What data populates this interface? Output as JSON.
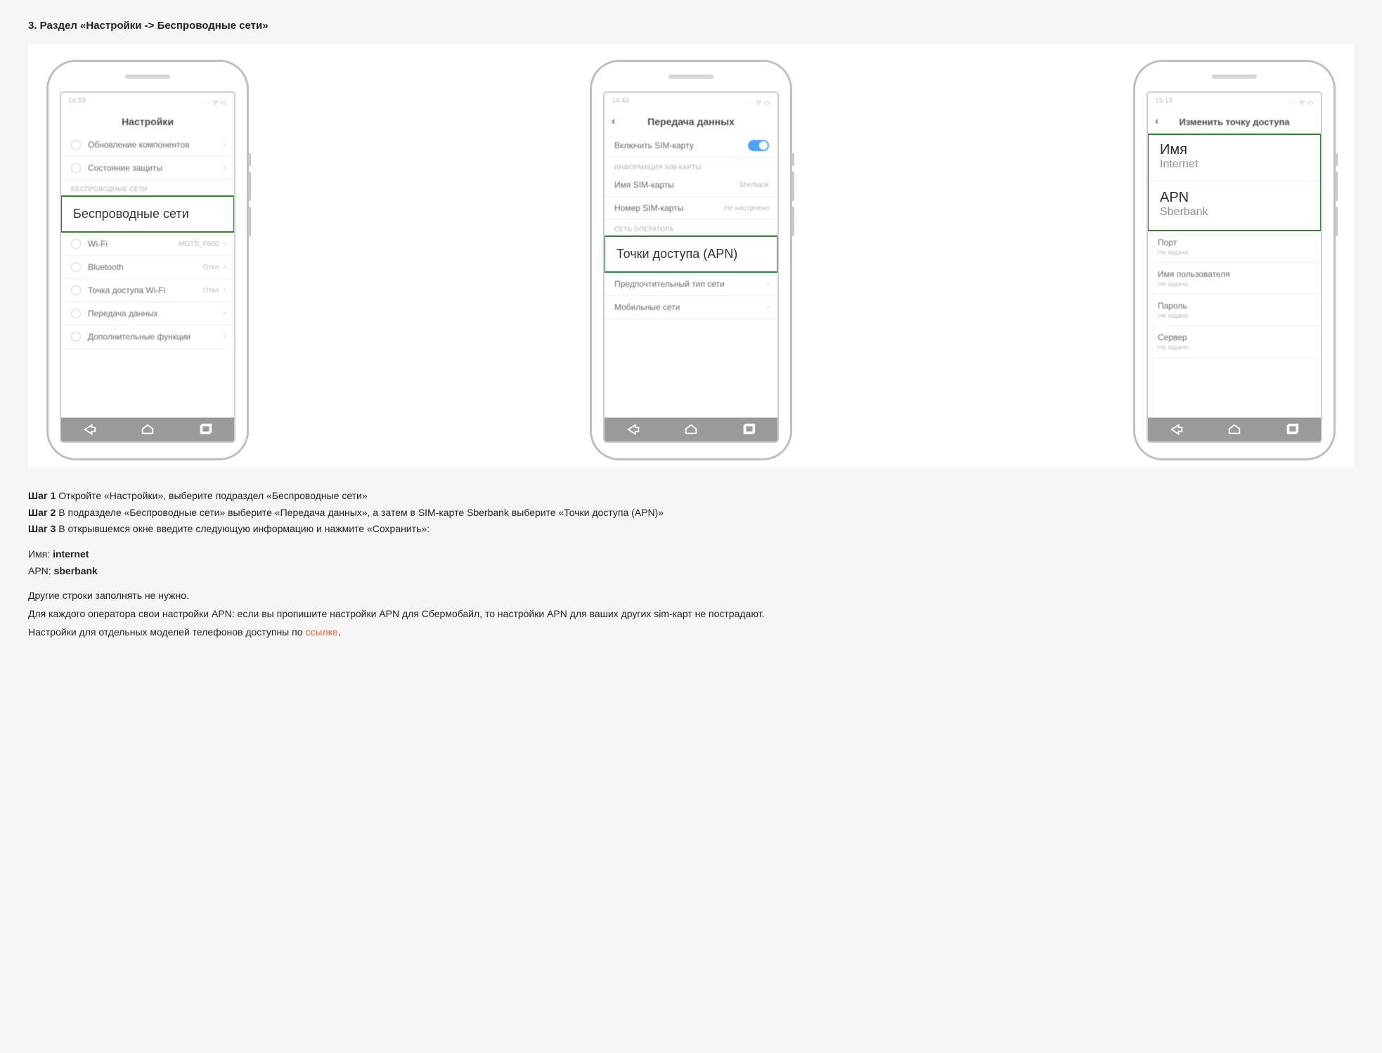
{
  "heading": "3. Раздел «Настройки -> Беспроводные сети»",
  "phones": {
    "p1": {
      "status_time": "14:59",
      "status_right": "⋯ ᯤ ▭",
      "title": "Настройки",
      "rows": {
        "r1": "Обновление компонентов",
        "r2": "Состояние защиты",
        "sec1": "БЕСПРОВОДНЫЕ СЕТИ",
        "hl": "Беспроводные сети",
        "wifi": "Wi-Fi",
        "wifi_v": "MGTS_F900",
        "bt": "Bluetooth",
        "bt_v": "Откл",
        "ap": "Точка доступа Wi-Fi",
        "ap_v": "Откл",
        "data": "Передача данных",
        "more": "Дополнительные функции"
      }
    },
    "p2": {
      "status_time": "14:48",
      "status_right": "⋯ ᯤ ▭",
      "title": "Передача данных",
      "rows": {
        "sim_on": "Включить SIM-карту",
        "sec1": "ИНФОРМАЦИЯ SIM-КАРТЫ",
        "sim_name": "Имя SIM-карты",
        "sim_name_v": "Sberbank",
        "sim_num": "Номер SIM-карты",
        "sim_num_v": "Не настроено",
        "sec2": "СЕТЬ ОПЕРАТОРА",
        "hl": "Точки доступа (APN)",
        "pref": "Предпочтительный тип сети",
        "mob": "Мобильные сети"
      }
    },
    "p3": {
      "status_time": "15:19",
      "status_right": "⋯ ᯤ ▭",
      "title": "Изменить точку доступа",
      "hl": {
        "name_l": "Имя",
        "name_v": "Internet",
        "apn_l": "APN",
        "apn_v": "Sberbank"
      },
      "rows": {
        "port": "Порт",
        "ns": "Не задано",
        "user": "Имя пользователя",
        "pass": "Пароль",
        "server": "Сервер"
      }
    }
  },
  "instr": {
    "s1b": "Шаг 1 ",
    "s1t": "Откройте «Настройки», выберите подраздел «Беспроводные сети»",
    "s2b": "Шаг 2 ",
    "s2t": "В подразделе «Беспроводные сети» выберите «Передача данных», а затем в SIM-карте Sberbank выберите «Точки доступа (APN)»",
    "s3b": "Шаг 3 ",
    "s3t": "В открывшемся окне введите следующую информацию и нажмите «Сохранить»:",
    "val1l": "Имя: ",
    "val1v": "internet",
    "val2l": "APN: ",
    "val2v": "sberbank",
    "other1": "Другие строки заполнять не нужно.",
    "other2": "Для каждого оператора свои настройки APN: если вы пропишите настройки APN для Сбермобайл, то настройки APN для ваших других sim-карт не пострадают.",
    "other3a": "Настройки для отдельных моделей телефонов доступны по ",
    "link": "ссылке",
    "other3b": "."
  }
}
